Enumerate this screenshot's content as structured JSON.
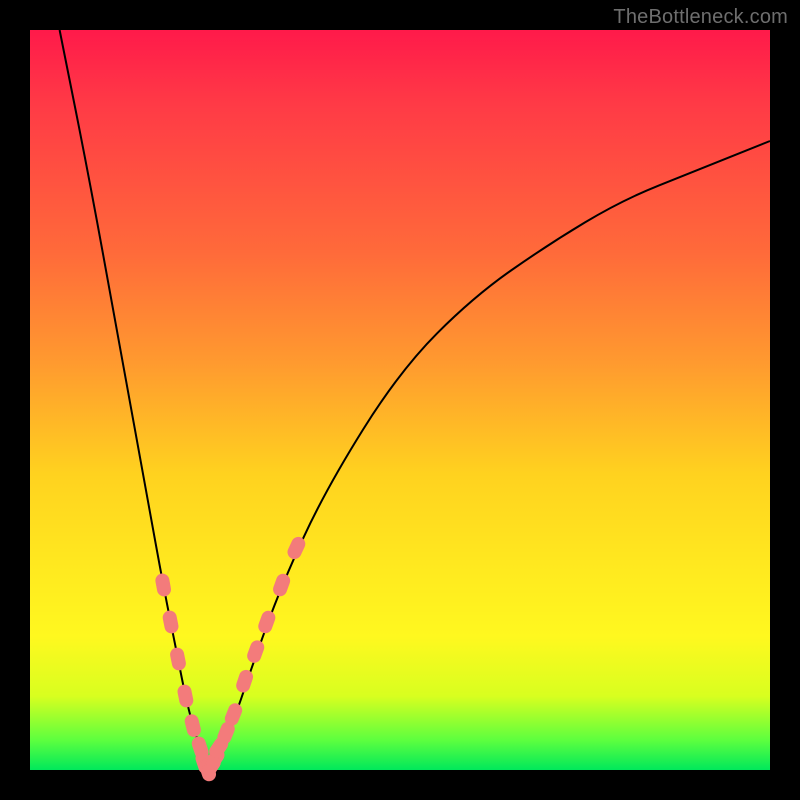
{
  "watermark": "TheBottleneck.com",
  "chart_data": {
    "type": "line",
    "title": "",
    "xlabel": "",
    "ylabel": "",
    "xlim": [
      0,
      100
    ],
    "ylim": [
      0,
      100
    ],
    "legend": false,
    "grid": false,
    "background_gradient": {
      "stops": [
        {
          "pct": 0,
          "color": "#ff1a4a"
        },
        {
          "pct": 30,
          "color": "#ff6a3a"
        },
        {
          "pct": 60,
          "color": "#ffd21f"
        },
        {
          "pct": 82,
          "color": "#fff81f"
        },
        {
          "pct": 96,
          "color": "#5cff3f"
        },
        {
          "pct": 100,
          "color": "#00e85b"
        }
      ]
    },
    "series": [
      {
        "name": "left-branch",
        "x": [
          4,
          8,
          12,
          16,
          18,
          20,
          21,
          22,
          23,
          24
        ],
        "y": [
          100,
          80,
          58,
          36,
          25,
          15,
          10,
          6,
          3,
          0
        ]
      },
      {
        "name": "right-branch",
        "x": [
          24,
          26,
          28,
          30,
          34,
          40,
          50,
          60,
          70,
          80,
          90,
          100
        ],
        "y": [
          0,
          3,
          8,
          14,
          25,
          38,
          54,
          64,
          71,
          77,
          81,
          85
        ]
      }
    ],
    "beads": {
      "comment": "pink capsule markers clustered near the minimum, shown on both branches roughly between y=6 and y=30",
      "left": [
        {
          "x": 18.0,
          "y": 25
        },
        {
          "x": 19.0,
          "y": 20
        },
        {
          "x": 20.0,
          "y": 15
        },
        {
          "x": 21.0,
          "y": 10
        },
        {
          "x": 22.0,
          "y": 6
        },
        {
          "x": 23.0,
          "y": 3
        },
        {
          "x": 23.5,
          "y": 1
        },
        {
          "x": 24.0,
          "y": 0
        }
      ],
      "right": [
        {
          "x": 24.5,
          "y": 0.5
        },
        {
          "x": 25.0,
          "y": 1.5
        },
        {
          "x": 25.5,
          "y": 3
        },
        {
          "x": 26.5,
          "y": 5
        },
        {
          "x": 27.5,
          "y": 7.5
        },
        {
          "x": 29.0,
          "y": 12
        },
        {
          "x": 30.5,
          "y": 16
        },
        {
          "x": 32.0,
          "y": 20
        },
        {
          "x": 34.0,
          "y": 25
        },
        {
          "x": 36.0,
          "y": 30
        }
      ]
    }
  }
}
